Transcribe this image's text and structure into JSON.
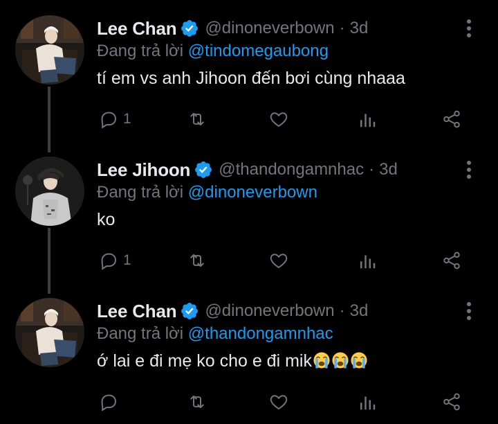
{
  "colors": {
    "background": "#000000",
    "text_primary": "#e7e9ea",
    "text_secondary": "#71767b",
    "accent": "#1d9bf0",
    "thread_line": "#3a3f44"
  },
  "icons": {
    "verified": "verified-badge-icon",
    "more": "more-vertical-icon",
    "reply": "reply-bubble-icon",
    "retweet": "retweet-icon",
    "like": "heart-icon",
    "stats": "analytics-bars-icon",
    "share": "share-icon"
  },
  "reply_prefix": "Đang trả lời",
  "tweets": [
    {
      "display_name": "Lee Chan",
      "handle": "@dinoneverbown",
      "separator": "·",
      "time": "3d",
      "reply_to": "@tindomegaubong",
      "text": "tí em vs anh Jihoon đến bơi cùng nhaaa",
      "emoji_count": 0,
      "reply_count": "1"
    },
    {
      "display_name": "Lee Jihoon",
      "handle": "@thandongamnhac",
      "separator": "·",
      "time": "3d",
      "reply_to": "@dinoneverbown",
      "text": "ko",
      "emoji_count": 0,
      "reply_count": "1"
    },
    {
      "display_name": "Lee Chan",
      "handle": "@dinoneverbown",
      "separator": "·",
      "time": "3d",
      "reply_to": "@thandongamnhac",
      "text": "ớ lai e đi mẹ ko cho e đi mik",
      "emoji": "loudly-crying-face",
      "emoji_count": 3,
      "reply_count": ""
    }
  ]
}
